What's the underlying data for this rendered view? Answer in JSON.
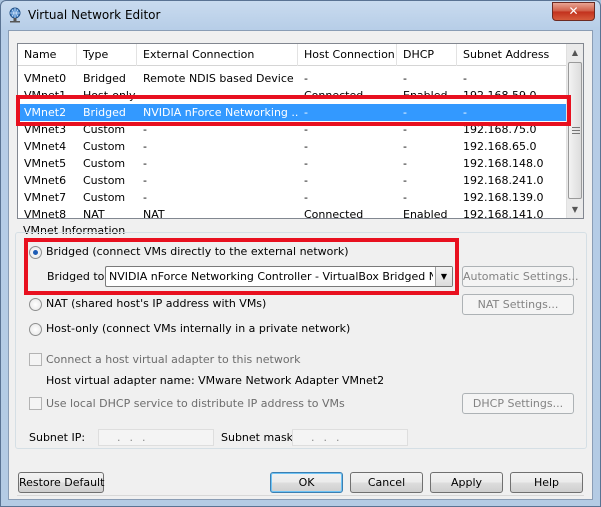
{
  "window": {
    "title": "Virtual Network Editor",
    "close_glyph": "✕"
  },
  "table": {
    "columns": [
      "Name",
      "Type",
      "External Connection",
      "Host Connection",
      "DHCP",
      "Subnet Address"
    ],
    "rows": [
      [
        "VMnet0",
        "Bridged",
        "Remote NDIS based Device ...",
        "-",
        "-",
        "-"
      ],
      [
        "VMnet1",
        "Host-only",
        "-",
        "Connected",
        "Enabled",
        "192.168.59.0"
      ],
      [
        "VMnet2",
        "Bridged",
        "NVIDIA nForce Networking ...",
        "-",
        "-",
        "-"
      ],
      [
        "VMnet3",
        "Custom",
        "-",
        "-",
        "-",
        "192.168.75.0"
      ],
      [
        "VMnet4",
        "Custom",
        "-",
        "-",
        "-",
        "192.168.65.0"
      ],
      [
        "VMnet5",
        "Custom",
        "-",
        "-",
        "-",
        "192.168.148.0"
      ],
      [
        "VMnet6",
        "Custom",
        "-",
        "-",
        "-",
        "192.168.241.0"
      ],
      [
        "VMnet7",
        "Custom",
        "-",
        "-",
        "-",
        "192.168.139.0"
      ],
      [
        "VMnet8",
        "NAT",
        "NAT",
        "Connected",
        "Enabled",
        "192.168.141.0"
      ]
    ],
    "selected_row": "VMnet2"
  },
  "info": {
    "group_label": "VMnet Information",
    "bridged_label": "Bridged (connect VMs directly to the external network)",
    "bridged_to_label": "Bridged to:",
    "bridged_to_value": "NVIDIA nForce Networking Controller - VirtualBox Bridged Networkin",
    "auto_settings": "Automatic Settings...",
    "nat_label": "NAT (shared host's IP address with VMs)",
    "nat_settings": "NAT Settings...",
    "hostonly_label": "Host-only (connect VMs internally in a private network)",
    "connect_adapter_label": "Connect a host virtual adapter to this network",
    "adapter_name_label": "Host virtual adapter name: VMware Network Adapter VMnet2",
    "dhcp_label": "Use local DHCP service to distribute IP address to VMs",
    "dhcp_settings": "DHCP Settings...",
    "subnet_ip_label": "Subnet IP:",
    "subnet_ip_value": "...",
    "subnet_mask_label": "Subnet mask:",
    "subnet_mask_value": "..."
  },
  "buttons": {
    "restore": "Restore Default",
    "ok": "OK",
    "cancel": "Cancel",
    "apply": "Apply",
    "help": "Help"
  },
  "colors": {
    "selection": "#3399ff",
    "highlight": "#e8101f"
  }
}
